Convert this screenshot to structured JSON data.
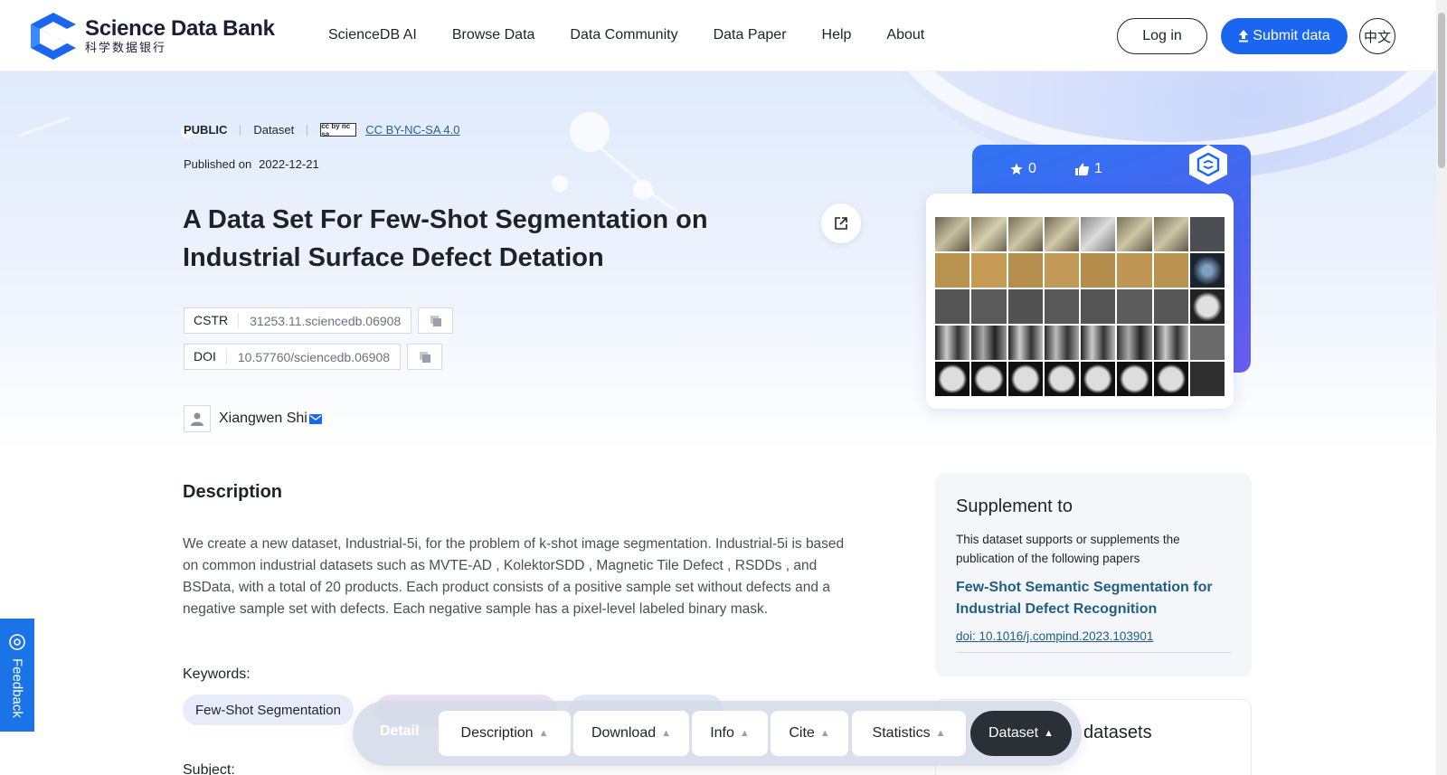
{
  "header": {
    "logo_en": "Science Data Bank",
    "logo_cn": "科学数据银行",
    "nav": [
      "ScienceDB AI",
      "Browse Data",
      "Data Community",
      "Data Paper",
      "Help",
      "About"
    ],
    "login_label": "Log in",
    "submit_label": "Submit data",
    "lang_label": "中文"
  },
  "dataset": {
    "visibility": "PUBLIC",
    "type": "Dataset",
    "license_badge": "cc by nc sa",
    "license": "CC BY-NC-SA 4.0",
    "published_label": "Published on",
    "published_date": "2022-12-21",
    "title": "A Data Set For Few-Shot Segmentation on Industrial Surface Defect Detation",
    "cstr_label": "CSTR",
    "cstr": "31253.11.sciencedb.06908",
    "doi_label": "DOI",
    "doi": "10.57760/sciencedb.06908",
    "author": "Xiangwen Shi",
    "description_heading": "Description",
    "description": "We create a new dataset, Industrial-5i, for the problem of k-shot image segmentation. Industrial-5i is based on common industrial datasets such as MVTE-AD , KolektorSDD , Magnetic Tile Defect , RSDDs , and BSData, with a total of 20 products. Each product consists of a positive sample set without defects and a negative sample set with defects. Each negative sample has a pixel-level labeled binary mask.",
    "keywords_label": "Keywords:",
    "keywords": [
      "Few-Shot Segmentation",
      "",
      ""
    ],
    "subject_label": "Subject:"
  },
  "stats": {
    "stars": "0",
    "likes": "1"
  },
  "supplement": {
    "title": "Supplement to",
    "desc": "This dataset supports or supplements the publication of the following papers",
    "paper_title": "Few-Shot Semantic Segmentation for Industrial Defect Recognition",
    "paper_doi": "doi: 10.1016/j.compind.2023.103901"
  },
  "related": {
    "title_tail": "datasets"
  },
  "feedback_label": "Feedback",
  "tabbar": {
    "detail": "Detail",
    "tabs": [
      "Description",
      "Download",
      "Info",
      "Cite",
      "Statistics",
      "Dataset"
    ],
    "active": "Dataset"
  },
  "colors": {
    "primary": "#1a66f0",
    "link": "#1f5f86",
    "feedback": "#1a74e8",
    "active_tab": "#2b2f36"
  }
}
